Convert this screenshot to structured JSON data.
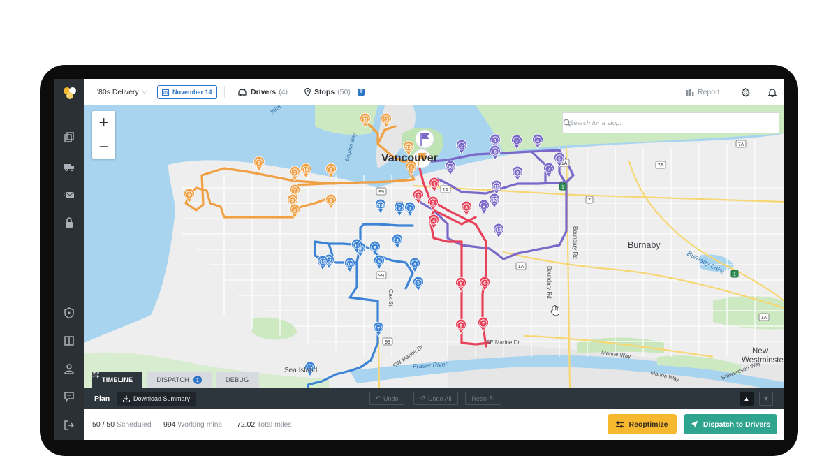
{
  "topbar": {
    "project": "'80s Delivery",
    "date": "November 14",
    "drivers_label": "Drivers",
    "drivers_count": "(4)",
    "stops_label": "Stops",
    "stops_count": "(50)",
    "report_label": "Report"
  },
  "map": {
    "search_placeholder": "Search for a stop...",
    "labels": {
      "vancouver": "Vancouver",
      "burnaby": "Burnaby",
      "new_westminster_1": "New",
      "new_westminster_2": "Westminster",
      "sea_island": "Sea Island",
      "burnaby_lake": "Burnaby Lake",
      "boundary_rd": "Boundary Rd",
      "marine_way": "Marine Way",
      "se_marine": "SE Marine Dr",
      "oak_st": "Oak St",
      "english_bay": "English Bay",
      "inlet": "Inlet",
      "fraser": "Fraser River",
      "sw_marine": "SW Marine Dr",
      "stewardson": "Stewardson Way"
    },
    "route_colors": {
      "orange": "#f0a044",
      "purple": "#7b69c9",
      "red": "#e8425a",
      "blue": "#3d84d6"
    }
  },
  "tabs": [
    {
      "label": "TIMELINE"
    },
    {
      "label": "DISPATCH",
      "badge": "1"
    },
    {
      "label": "DEBUG"
    }
  ],
  "planbar": {
    "title": "Plan",
    "download": "Download Summary",
    "undo": "Undo",
    "undo_all": "Undo All",
    "redo": "Redo"
  },
  "stats": {
    "scheduled_value": "50 / 50",
    "scheduled_label": "Scheduled",
    "working_value": "994",
    "working_label": "Working mins",
    "miles_value": "72.02",
    "miles_label": "Total miles"
  },
  "actions": {
    "reoptimize": "Reoptimize",
    "dispatch": "Dispatch to Drivers"
  },
  "markers": {
    "orange": [
      "11",
      "12",
      "14",
      "1",
      "8",
      "3",
      "10",
      "2",
      "9",
      "7",
      "5",
      "6",
      "4"
    ],
    "purple": [
      "1",
      "2",
      "3",
      "4",
      "5",
      "6",
      "7",
      "8",
      "9",
      "10",
      "11",
      "12",
      "13"
    ],
    "red": [
      "1",
      "2",
      "3",
      "4",
      "5",
      "6",
      "7",
      "8",
      "9"
    ],
    "blue": [
      "1",
      "2",
      "3",
      "4",
      "5",
      "6",
      "7",
      "8",
      "9",
      "10",
      "11",
      "12",
      "13",
      "14",
      "15"
    ]
  }
}
